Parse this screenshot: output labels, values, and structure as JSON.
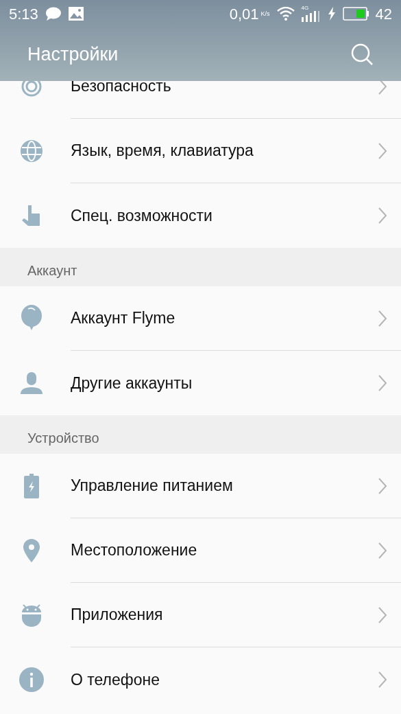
{
  "status_bar": {
    "time": "5:13",
    "speed": "0,01",
    "speed_unit": "K/s",
    "network": "4G",
    "battery": "42"
  },
  "header": {
    "title": "Настройки"
  },
  "sections": [
    {
      "items": [
        {
          "label": "Безопасность"
        },
        {
          "label": "Язык, время, клавиатура"
        },
        {
          "label": "Спец. возможности"
        }
      ]
    },
    {
      "title": "Аккаунт",
      "items": [
        {
          "label": "Аккаунт Flyme"
        },
        {
          "label": "Другие аккаунты"
        }
      ]
    },
    {
      "title": "Устройство",
      "items": [
        {
          "label": "Управление питанием"
        },
        {
          "label": "Местоположение"
        },
        {
          "label": "Приложения"
        },
        {
          "label": "О телефоне"
        }
      ]
    }
  ]
}
